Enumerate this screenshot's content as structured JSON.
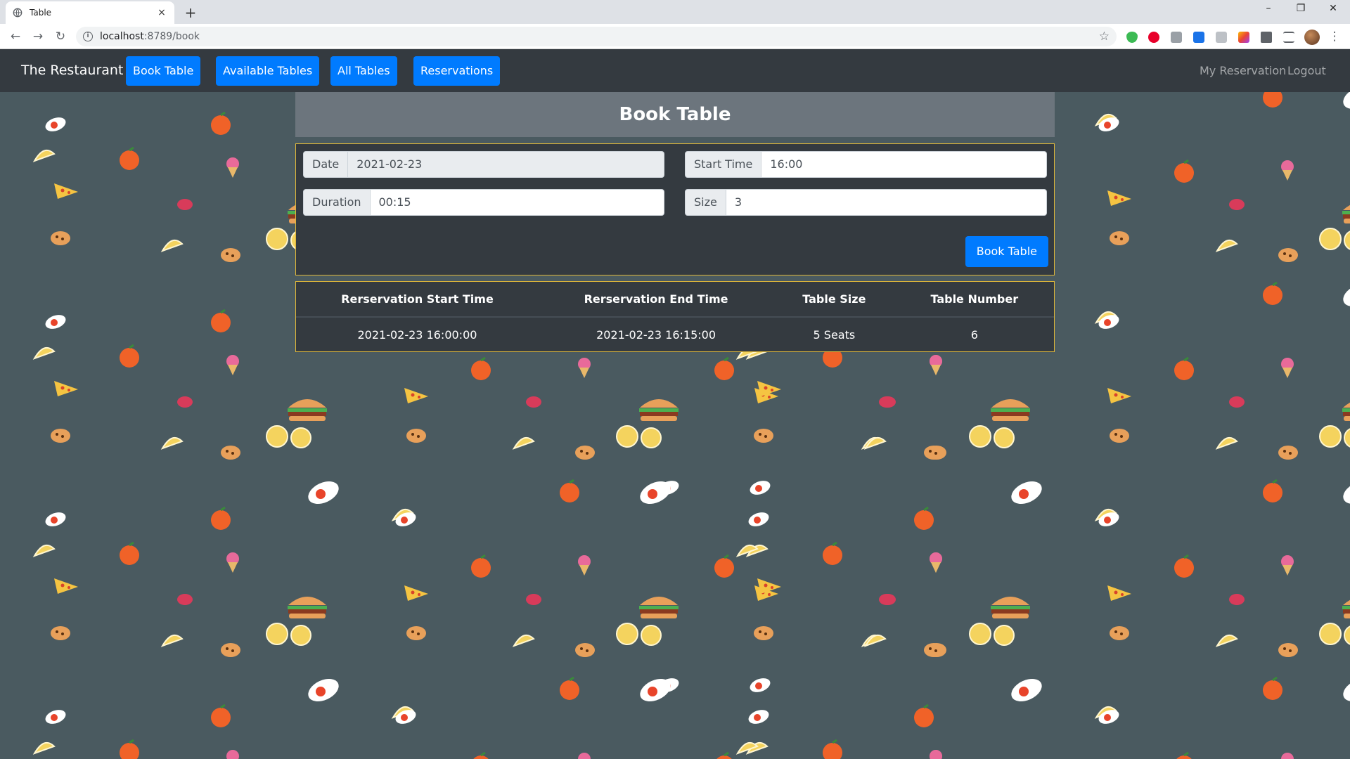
{
  "browser": {
    "tab_title": "Table",
    "new_tab_glyph": "+",
    "close_glyph": "×",
    "url_host": "localhost",
    "url_path": ":8789/book",
    "extension_icon_names": [
      "shield-extension-icon",
      "opera-icon",
      "print-icon",
      "window-icon",
      "reader-icon",
      "colorful-extension-icon",
      "puzzle-extension-icon",
      "playlist-icon"
    ]
  },
  "navbar": {
    "brand": "The Restaurant",
    "buttons": [
      "Book Table",
      "Available Tables",
      "All Tables",
      "Reservations"
    ],
    "right_links": [
      "My Reservation",
      "Logout"
    ],
    "button_color": "#007bff",
    "bar_color": "#343a40"
  },
  "page": {
    "title": "Book Table",
    "form": {
      "date_label": "Date",
      "date_value": "2021-02-23",
      "start_time_label": "Start Time",
      "start_time_value": "16:00",
      "duration_label": "Duration",
      "duration_value": "00:15",
      "size_label": "Size",
      "size_value": "3",
      "submit_label": "Book Table"
    },
    "table": {
      "headers": [
        "Rerservation Start Time",
        "Rerservation End Time",
        "Table Size",
        "Table Number"
      ],
      "rows": [
        [
          "2021-02-23 16:00:00",
          "2021-02-23 16:15:00",
          "5 Seats",
          "6"
        ]
      ]
    }
  },
  "theme": {
    "background": "#4a5a60",
    "panel_border": "#e0b83a",
    "header_panel": "#6c757d"
  }
}
